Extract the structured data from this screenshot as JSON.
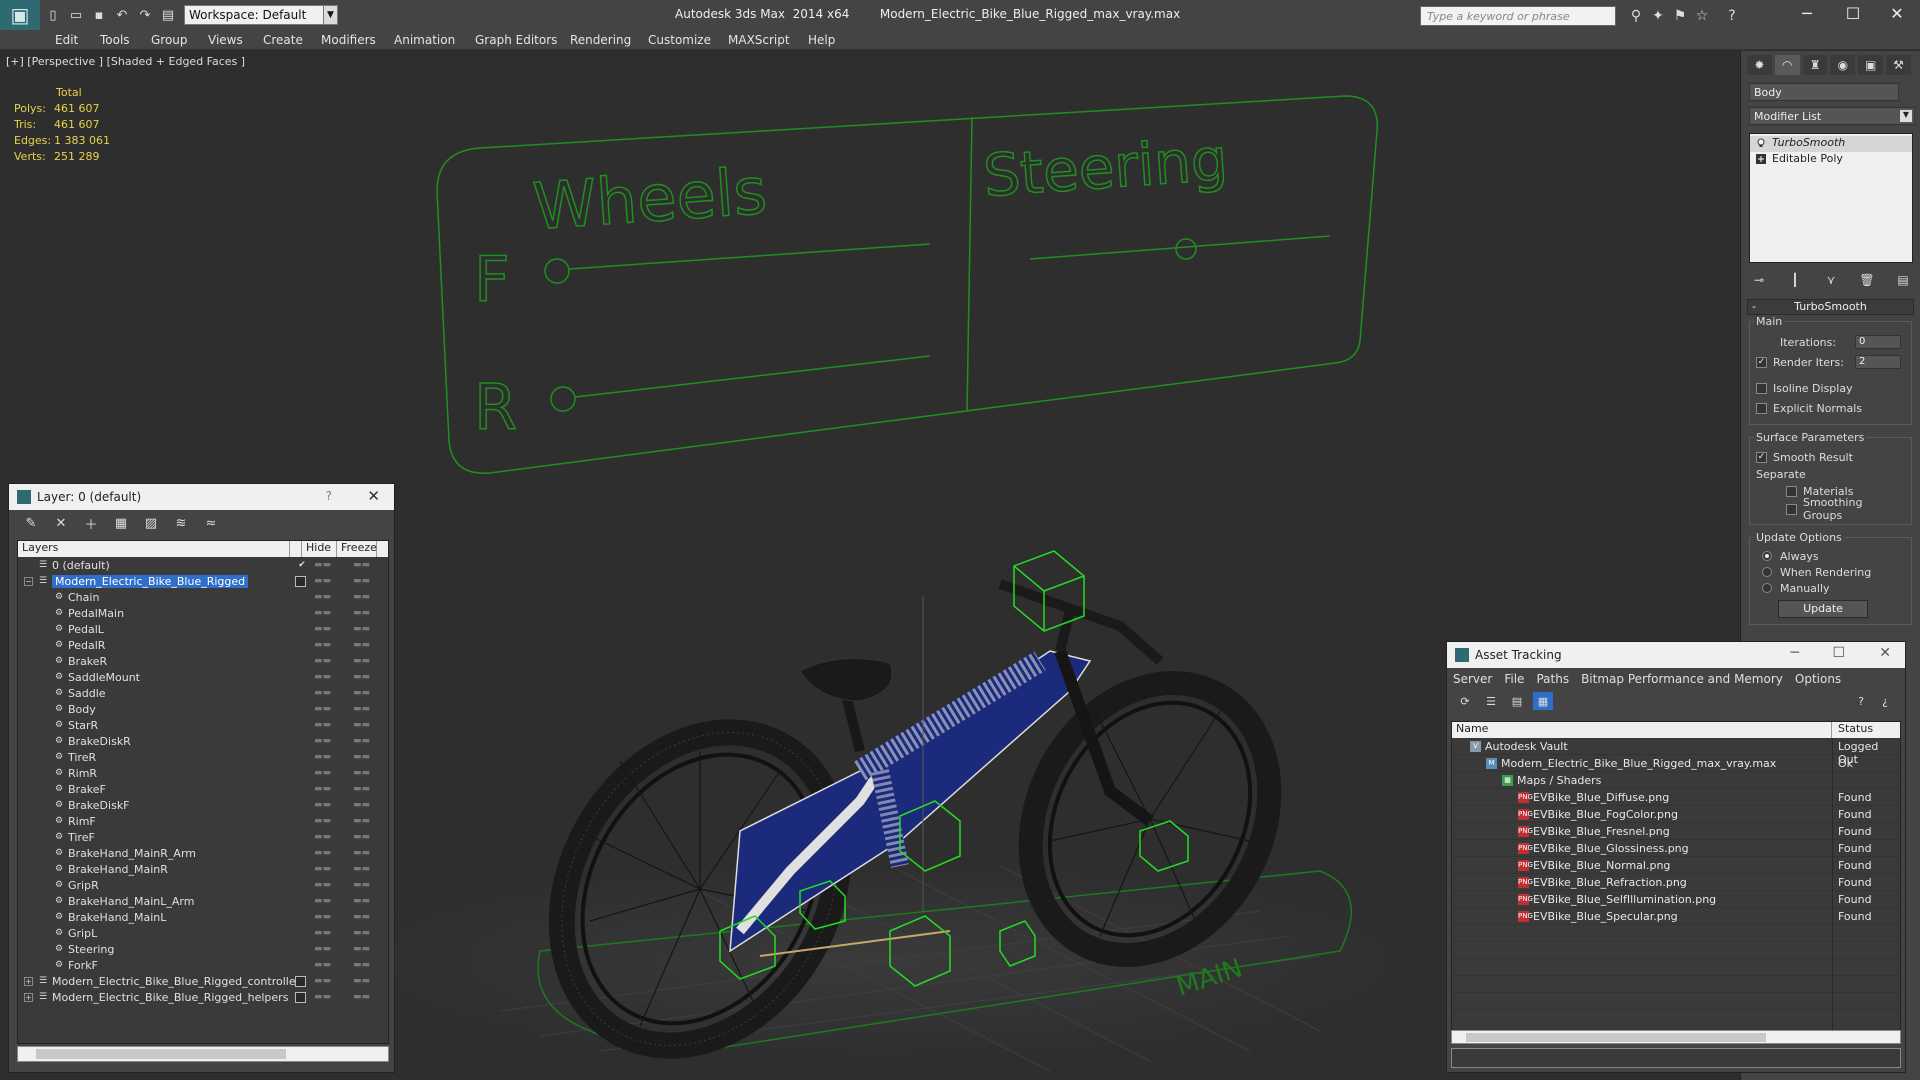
{
  "titlebar": {
    "workspace": "Workspace: Default",
    "title": "Autodesk 3ds Max  2014 x64        Modern_Electric_Bike_Blue_Rigged_max_vray.max",
    "search_placeholder": "Type a keyword or phrase"
  },
  "menu": [
    "Edit",
    "Tools",
    "Group",
    "Views",
    "Create",
    "Modifiers",
    "Animation",
    "Graph Editors",
    "Rendering",
    "Customize",
    "MAXScript",
    "Help"
  ],
  "viewport": {
    "label": "[+] [Perspective ] [Shaded + Edged Faces ]",
    "stats": {
      "header": "Total",
      "rows": [
        {
          "k": "Polys:",
          "v": "461 607"
        },
        {
          "k": "Tris:",
          "v": "461 607"
        },
        {
          "k": "Edges:",
          "v": "1 383 061"
        },
        {
          "k": "Verts:",
          "v": "251 289"
        }
      ]
    },
    "controller_labels": {
      "wheels": "Wheels",
      "steering": "Steering",
      "f": "F",
      "r": "R",
      "main": "MAIN"
    }
  },
  "layer_dialog": {
    "title": "Layer: 0 (default)",
    "help": "?",
    "columns": {
      "layers": "Layers",
      "hide": "Hide",
      "freeze": "Freeze"
    },
    "rows": [
      {
        "name": "0 (default)",
        "level": 0,
        "check": true
      },
      {
        "name": "Modern_Electric_Bike_Blue_Rigged",
        "level": 0,
        "selected": true,
        "expander": "−",
        "box": true
      },
      {
        "name": "Chain",
        "level": 1
      },
      {
        "name": "PedalMain",
        "level": 1
      },
      {
        "name": "PedalL",
        "level": 1
      },
      {
        "name": "PedalR",
        "level": 1
      },
      {
        "name": "BrakeR",
        "level": 1
      },
      {
        "name": "SaddleMount",
        "level": 1
      },
      {
        "name": "Saddle",
        "level": 1
      },
      {
        "name": "Body",
        "level": 1
      },
      {
        "name": "StarR",
        "level": 1
      },
      {
        "name": "BrakeDiskR",
        "level": 1
      },
      {
        "name": "TireR",
        "level": 1
      },
      {
        "name": "RimR",
        "level": 1
      },
      {
        "name": "BrakeF",
        "level": 1
      },
      {
        "name": "BrakeDiskF",
        "level": 1
      },
      {
        "name": "RimF",
        "level": 1
      },
      {
        "name": "TireF",
        "level": 1
      },
      {
        "name": "BrakeHand_MainR_Arm",
        "level": 1
      },
      {
        "name": "BrakeHand_MainR",
        "level": 1
      },
      {
        "name": "GripR",
        "level": 1
      },
      {
        "name": "BrakeHand_MainL_Arm",
        "level": 1
      },
      {
        "name": "BrakeHand_MainL",
        "level": 1
      },
      {
        "name": "GripL",
        "level": 1
      },
      {
        "name": "Steering",
        "level": 1
      },
      {
        "name": "ForkF",
        "level": 1
      },
      {
        "name": "Modern_Electric_Bike_Blue_Rigged_controllers",
        "level": 0,
        "expander": "+",
        "box": true
      },
      {
        "name": "Modern_Electric_Bike_Blue_Rigged_helpers",
        "level": 0,
        "expander": "+",
        "box": true
      }
    ]
  },
  "command_panel": {
    "object_name": "Body",
    "modifier_list": "Modifier List",
    "stack": [
      "TurboSmooth",
      "Editable Poly"
    ],
    "rollout": "TurboSmooth",
    "main_group": "Main",
    "iterations_label": "Iterations:",
    "iterations_value": "0",
    "render_iters_label": "Render Iters:",
    "render_iters_value": "2",
    "isoline": "Isoline Display",
    "explicit_normals": "Explicit Normals",
    "surface_group": "Surface Parameters",
    "smooth_result": "Smooth Result",
    "separate": "Separate",
    "materials": "Materials",
    "smoothing_groups": "Smoothing Groups",
    "update_group": "Update Options",
    "always": "Always",
    "when_rendering": "When Rendering",
    "manually": "Manually",
    "update_button": "Update"
  },
  "asset_tracking": {
    "title": "Asset Tracking",
    "menu": [
      "Server",
      "File",
      "Paths",
      "Bitmap Performance and Memory",
      "Options"
    ],
    "columns": {
      "name": "Name",
      "status": "Status"
    },
    "rows": [
      {
        "name": "Autodesk Vault",
        "status": "Logged Out",
        "indent": 0,
        "icon": "vault"
      },
      {
        "name": "Modern_Electric_Bike_Blue_Rigged_max_vray.max",
        "status": "Ok",
        "indent": 1,
        "icon": "max"
      },
      {
        "name": "Maps / Shaders",
        "status": "",
        "indent": 2,
        "icon": "maps"
      },
      {
        "name": "EVBike_Blue_Diffuse.png",
        "status": "Found",
        "indent": 3,
        "icon": "png"
      },
      {
        "name": "EVBike_Blue_FogColor.png",
        "status": "Found",
        "indent": 3,
        "icon": "png"
      },
      {
        "name": "EVBike_Blue_Fresnel.png",
        "status": "Found",
        "indent": 3,
        "icon": "png"
      },
      {
        "name": "EVBike_Blue_Glossiness.png",
        "status": "Found",
        "indent": 3,
        "icon": "png"
      },
      {
        "name": "EVBike_Blue_Normal.png",
        "status": "Found",
        "indent": 3,
        "icon": "png"
      },
      {
        "name": "EVBike_Blue_Refraction.png",
        "status": "Found",
        "indent": 3,
        "icon": "png"
      },
      {
        "name": "EVBike_Blue_SelfIllumination.png",
        "status": "Found",
        "indent": 3,
        "icon": "png"
      },
      {
        "name": "EVBike_Blue_Specular.png",
        "status": "Found",
        "indent": 3,
        "icon": "png"
      }
    ]
  }
}
